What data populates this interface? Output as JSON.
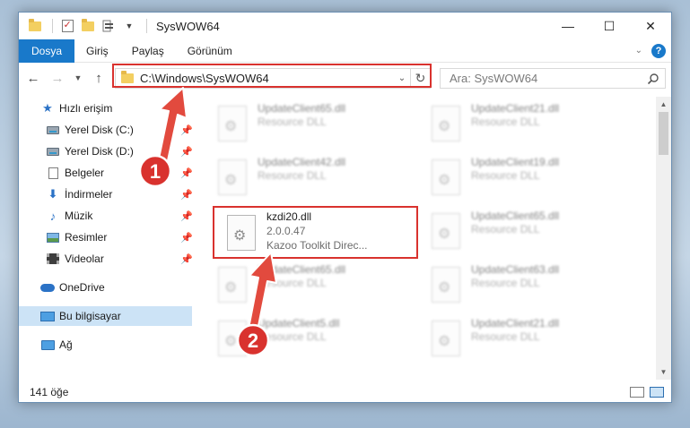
{
  "window": {
    "title": "SysWOW64",
    "controls": {
      "minimize": "—",
      "maximize": "☐",
      "close": "✕"
    }
  },
  "ribbon": {
    "tabs": [
      "Dosya",
      "Giriş",
      "Paylaş",
      "Görünüm"
    ]
  },
  "address": {
    "path": "C:\\Windows\\SysWOW64",
    "search_placeholder": "Ara: SysWOW64"
  },
  "sidebar": {
    "items": [
      {
        "label": "Hızlı erişim",
        "icon": "star-icon",
        "pinned": false
      },
      {
        "label": "Yerel Disk (C:)",
        "icon": "drive-icon",
        "pinned": true
      },
      {
        "label": "Yerel Disk (D:)",
        "icon": "drive-icon",
        "pinned": true
      },
      {
        "label": "Belgeler",
        "icon": "documents-icon",
        "pinned": true
      },
      {
        "label": "İndirmeler",
        "icon": "download-icon",
        "pinned": true
      },
      {
        "label": "Müzik",
        "icon": "music-icon",
        "pinned": true
      },
      {
        "label": "Resimler",
        "icon": "pictures-icon",
        "pinned": true
      },
      {
        "label": "Videolar",
        "icon": "videos-icon",
        "pinned": true
      },
      {
        "label": "OneDrive",
        "icon": "onedrive-icon",
        "pinned": false
      },
      {
        "label": "Bu bilgisayar",
        "icon": "this-pc-icon",
        "pinned": false,
        "selected": true
      },
      {
        "label": "Ağ",
        "icon": "network-icon",
        "pinned": false
      }
    ]
  },
  "files": [
    {
      "name": "UpdateClient65.dll",
      "type": "Resource DLL"
    },
    {
      "name": "UpdateClient21.dll",
      "type": "Resource DLL"
    },
    {
      "name": "UpdateClient42.dll",
      "type": "Resource DLL"
    },
    {
      "name": "UpdateClient19.dll",
      "type": "Resource DLL"
    },
    {
      "name": "kzdi20.dll",
      "version": "2.0.0.47",
      "type": "Kazoo Toolkit Direc...",
      "highlighted": true
    },
    {
      "name": "UpdateClient65.dll",
      "type": "Resource DLL"
    },
    {
      "name": "UpdateClient65.dll",
      "type": "Resource DLL"
    },
    {
      "name": "UpdateClient63.dll",
      "type": "Resource DLL"
    },
    {
      "name": "UpdateClient5.dll",
      "type": "Resource DLL"
    },
    {
      "name": "UpdateClient21.dll",
      "type": "Resource DLL"
    }
  ],
  "status": {
    "item_count": "141 öğe"
  },
  "annotations": {
    "step1": "1",
    "step2": "2"
  },
  "colors": {
    "accent": "#1979ca",
    "highlight": "#d9322e",
    "selected": "#cce3f6"
  }
}
